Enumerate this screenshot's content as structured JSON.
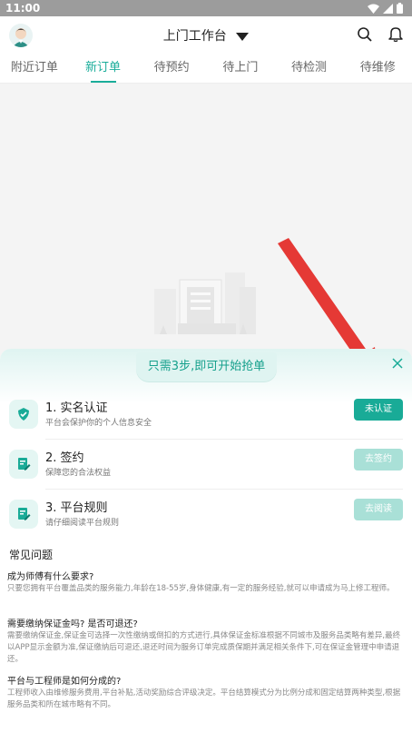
{
  "status": {
    "time": "11:00"
  },
  "header": {
    "title": "上门工作台"
  },
  "tabs": [
    {
      "label": "附近订单",
      "active": false
    },
    {
      "label": "新订单",
      "active": true
    },
    {
      "label": "待预约",
      "active": false
    },
    {
      "label": "待上门",
      "active": false
    },
    {
      "label": "待检测",
      "active": false
    },
    {
      "label": "待维修",
      "active": false
    }
  ],
  "sheet": {
    "banner": "只需3步,即可开始抢单",
    "steps": [
      {
        "title": "1. 实名认证",
        "desc": "平台会保护你的个人信息安全",
        "button": "未认证",
        "icon": "shield-check-icon"
      },
      {
        "title": "2. 签约",
        "desc": "保障您的合法权益",
        "button": "去签约",
        "icon": "edit-document-icon"
      },
      {
        "title": "3. 平台规则",
        "desc": "请仔细阅读平台规则",
        "button": "去阅读",
        "icon": "edit-document-icon"
      }
    ],
    "faq_title": "常见问题",
    "faq": [
      {
        "q": "成为师傅有什么要求?",
        "a": "只要您拥有平台覆盖品类的服务能力,年龄在18-55岁,身体健康,有一定的服务经验,就可以申请成为马上修工程师。"
      },
      {
        "q": "需要缴纳保证金吗? 是否可退还?",
        "a": "需要缴纳保证金,保证金可选择一次性缴纳或倒扣的方式进行,具体保证金标准根据不同城市及服务品类略有差异,最终以APP显示金额为准,保证缴纳后可退还,退还时间为服务订单完成质保期并满足相关条件下,可在保证金管理中申请退还。"
      },
      {
        "q": "平台与工程师是如何分成的?",
        "a": "工程师收入由维修服务费用,平台补贴,活动奖励综合评级决定。平台结算模式分为比例分成和固定结算两种类型,根据服务品类和所在城市略有不同。"
      }
    ]
  },
  "colors": {
    "accent": "#19ab97",
    "accent_light": "#a9e0d7",
    "arrow": "#e53935"
  }
}
